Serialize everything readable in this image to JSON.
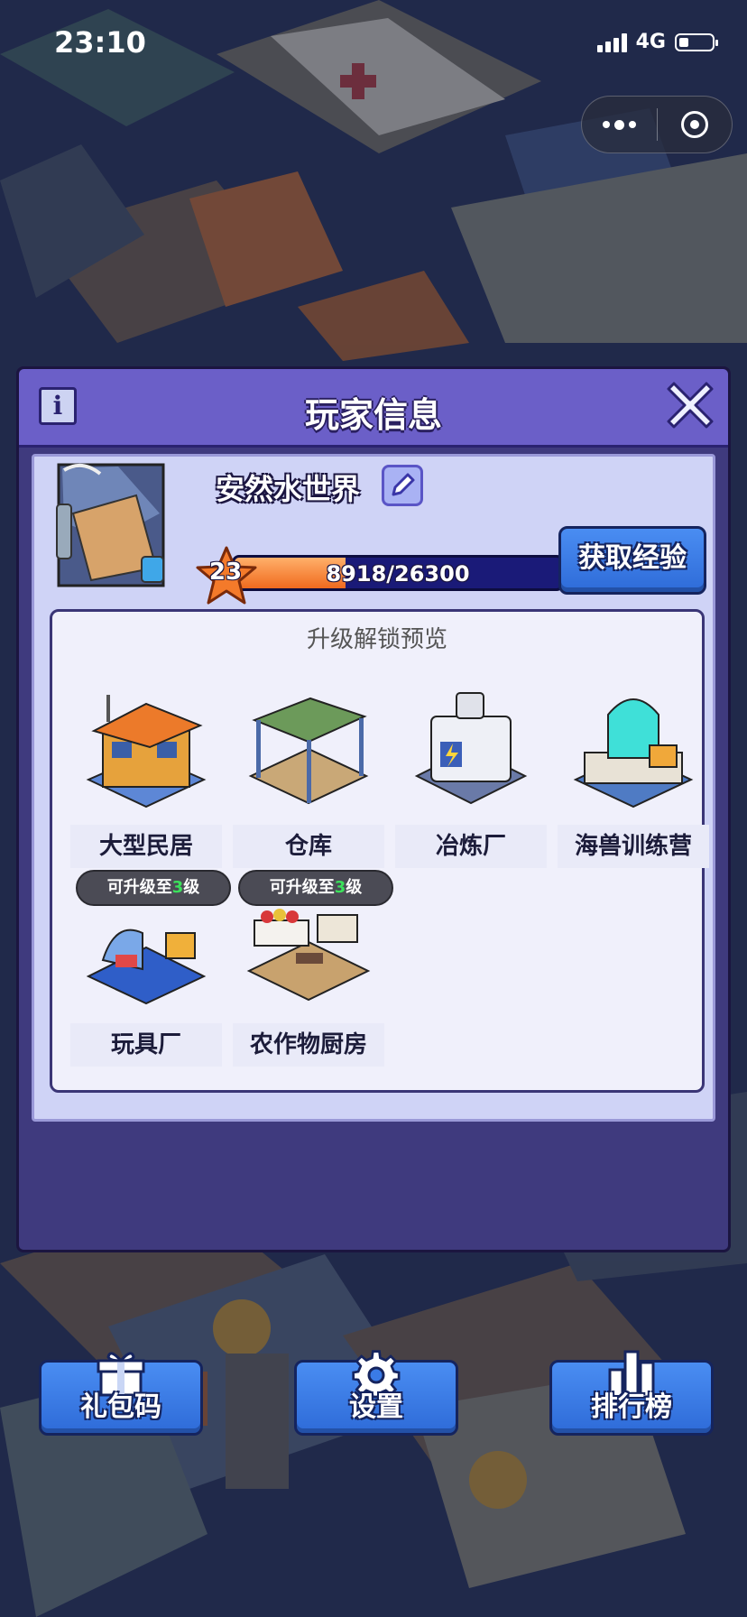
{
  "status_bar": {
    "time": "23:10",
    "network": "4G"
  },
  "dialog": {
    "title": "玩家信息",
    "info_icon_glyph": "i",
    "player": {
      "name": "安然水世界",
      "level": "23",
      "xp_text": "8918/26300",
      "xp_current": 8918,
      "xp_max": 26300
    },
    "get_xp_button": "获取经验",
    "preview": {
      "title": "升级解锁预览",
      "buildings": [
        {
          "label": "大型民居",
          "icon": "large-house-icon",
          "badge_prefix": "",
          "badge_level": "",
          "badge_suffix": ""
        },
        {
          "label": "仓库",
          "icon": "warehouse-icon",
          "badge_prefix": "",
          "badge_level": "",
          "badge_suffix": ""
        },
        {
          "label": "冶炼厂",
          "icon": "smelter-icon",
          "badge_prefix": "",
          "badge_level": "",
          "badge_suffix": ""
        },
        {
          "label": "海兽训练营",
          "icon": "sea-beast-camp-icon",
          "badge_prefix": "",
          "badge_level": "",
          "badge_suffix": ""
        },
        {
          "label": "玩具厂",
          "icon": "toy-factory-icon",
          "badge_prefix": "可升级至",
          "badge_level": "3",
          "badge_suffix": "级"
        },
        {
          "label": "农作物厨房",
          "icon": "crop-kitchen-icon",
          "badge_prefix": "可升级至",
          "badge_level": "3",
          "badge_suffix": "级"
        }
      ]
    },
    "bottom_buttons": [
      {
        "label": "礼包码",
        "icon": "gift-icon"
      },
      {
        "label": "设置",
        "icon": "gear-icon"
      },
      {
        "label": "排行榜",
        "icon": "leaderboard-icon"
      }
    ]
  },
  "colors": {
    "header": "#6b5fc8",
    "panel": "#cfd3f6",
    "button_blue": "#3a7be6",
    "xp_fill": "#f58a3c",
    "badge_level": "#3be05b"
  }
}
